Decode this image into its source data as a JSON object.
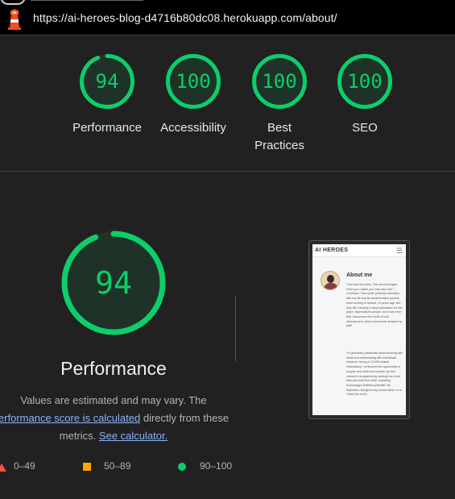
{
  "browser": {
    "url": "https://ai-heroes-blog-d4716b80dc08.herokuapp.com/about/",
    "app_icon": "lighthouse-icon"
  },
  "summary_gauges": [
    {
      "label": "Performance",
      "score": "94",
      "fraction": 0.94,
      "color": "#0cce6b"
    },
    {
      "label": "Accessibility",
      "score": "100",
      "fraction": 1.0,
      "color": "#0cce6b"
    },
    {
      "label": "Best Practices",
      "label_line1": "Best",
      "label_line2": "Practices",
      "score": "100",
      "fraction": 1.0,
      "color": "#0cce6b"
    },
    {
      "label": "SEO",
      "score": "100",
      "fraction": 1.0,
      "color": "#0cce6b"
    }
  ],
  "main": {
    "score": "94",
    "fraction": 0.94,
    "title": "Performance",
    "desc_line1": "Values are estimated and may vary. The",
    "desc_link1": "erformance score is calculated",
    "desc_line2_rest": " directly from these",
    "desc_line3": "metrics. ",
    "desc_link2": "See calculator."
  },
  "legend": [
    {
      "shape": "triangle",
      "color": "#ff4e42",
      "range": "0–49"
    },
    {
      "shape": "square",
      "color": "#ffa400",
      "range": "50–89"
    },
    {
      "shape": "circle",
      "color": "#0cce6b",
      "range": "90–100"
    }
  ],
  "thumbnail": {
    "logo": "AI HEROES",
    "menu_icon": "hamburger-menu-icon",
    "heading": "About me",
    "para1": "\"You have two lives. The second begins when you realize you only have one.\" – Confucius. This quote perfectly resonates with my life and its transformative journey since arriving in Ireland, 10 years ago. Not only did I develop a deep admiration for this place, especially its people, but it was here that I discovered the world of self-development, which has forever shaped my path.",
    "para2": "I'm genuinely passionate about working with ideas and collaborating with individuals. However, facing a COVID-related redundancy, I embraced the opportunity to acquire new skills and explore my true interest in programming, seeing it as more than just code but rather unlocking technology's limitless potential. My aspiration, though it may sound cliche, is to \"make the world"
  },
  "colors": {
    "pass": "#0cce6b",
    "average": "#ffa400",
    "fail": "#ff4e42",
    "link": "#8ab4f8",
    "background": "#212121"
  }
}
